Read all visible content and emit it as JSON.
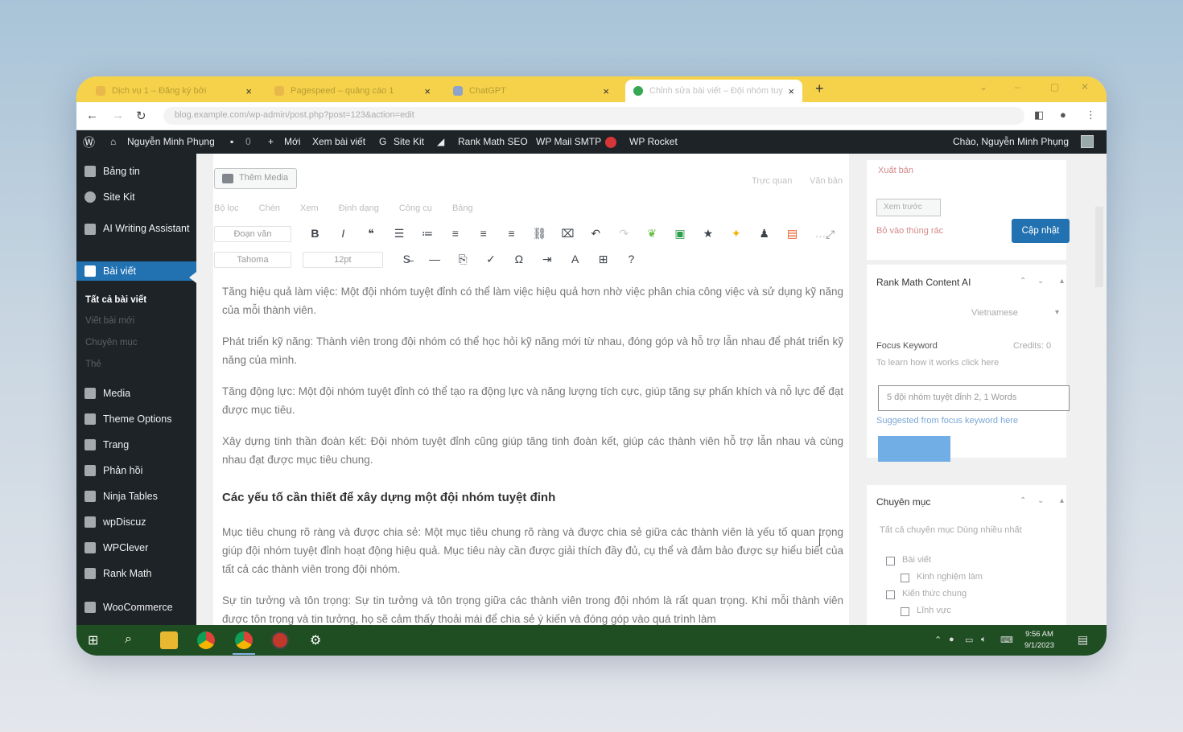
{
  "browser": {
    "tabs": [
      {
        "title": "Dịch vụ 1 – Đăng ký bởi",
        "active": false
      },
      {
        "title": "Pagespeed – quảng cáo 1",
        "active": false
      },
      {
        "title": "ChatGPT",
        "active": false
      },
      {
        "title": "Chỉnh sửa bài viết – Đội nhóm tuyệt",
        "active": true
      }
    ],
    "url": "blog.example.com/wp-admin/post.php?post=123&action=edit"
  },
  "admin_bar": {
    "site_name": "Nguyễn Minh Phụng",
    "comments": "0",
    "new": "Mới",
    "view_post": "Xem bài viết",
    "site_kit": "Site Kit",
    "rank_math": "Rank Math SEO",
    "wp_mail": "WP Mail SMTP",
    "wp_rocket": "WP Rocket",
    "greeting": "Chào, Nguyễn Minh Phụng"
  },
  "sidebar": {
    "items": {
      "dashboard": "Bảng tin",
      "site_kit": "Site Kit",
      "ai_writing": "AI Writing Assistant",
      "posts": "Bài viết",
      "media": "Media",
      "theme_options": "Theme Options",
      "pages": "Trang",
      "comments": "Phản hồi",
      "ninja_tables": "Ninja Tables",
      "wpdiscuz": "wpDiscuz",
      "wpclever": "WPClever",
      "rank_math": "Rank Math",
      "woocommerce": "WooCommerce"
    },
    "sub": {
      "all_posts": "Tất cả bài viết",
      "add_new": "Viết bài mới",
      "categories": "Chuyên mục",
      "tags": "Thẻ"
    }
  },
  "editor": {
    "add_media": "Thêm Media",
    "tab_visual": "Trực quan",
    "tab_text": "Văn bản",
    "toolbar_row1": [
      "Bộ lọc",
      "Chèn",
      "Xem",
      "Định dạng",
      "Công cụ",
      "Bảng"
    ],
    "format_select": "Đoạn văn",
    "font_select": "Tahoma",
    "size_select": "12pt",
    "paragraphs": [
      "Tăng hiệu quả làm việc: Một đội nhóm tuyệt đỉnh có thể làm việc hiệu quả hơn nhờ việc phân chia công việc và sử dụng kỹ năng của mỗi thành viên.",
      "Phát triển kỹ năng: Thành viên trong đội nhóm có thể học hỏi kỹ năng mới từ nhau, đóng góp và hỗ trợ lẫn nhau để phát triển kỹ năng của mình.",
      "Tăng động lực: Một đội nhóm tuyệt đỉnh có thể tạo ra động lực và năng lượng tích cực, giúp tăng sự phấn khích và nỗ lực để đạt được mục tiêu.",
      "Xây dựng tinh thần đoàn kết: Đội nhóm tuyệt đỉnh cũng giúp tăng tinh đoàn kết, giúp các thành viên hỗ trợ lẫn nhau và cùng nhau đạt được mục tiêu chung."
    ],
    "heading": "Các yếu tố cần thiết để xây dựng một đội nhóm tuyệt đỉnh",
    "paragraphs2": [
      "Mục tiêu chung rõ ràng và được chia sẻ: Một mục tiêu chung rõ ràng và được chia sẻ giữa các thành viên là yếu tố quan trọng giúp đội nhóm tuyệt đỉnh hoạt động hiệu quả. Mục tiêu này cần được giải thích đầy đủ, cụ thể và đảm bảo được sự hiểu biết của tất cả các thành viên trong đội nhóm.",
      "Sự tin tưởng và tôn trọng: Sự tin tưởng và tôn trọng giữa các thành viên trong đội nhóm là rất quan trọng. Khi mỗi thành viên được tôn trọng và tin tưởng, họ sẽ cảm thấy thoải mái để chia sẻ ý kiến và đóng góp vào quá trình làm"
    ]
  },
  "right_panel": {
    "publish_title": "Xuất bản",
    "preview": "Xem trước",
    "move_trash": "Bỏ vào thùng rác",
    "update": "Cập nhật",
    "rank_math_title": "Rank Math Content AI",
    "country": "Vietnamese",
    "focus_keyword": "Focus Keyword",
    "credits": "Credits: 0",
    "hint": "To learn how it works click here",
    "keyword_value": "5 đội nhóm tuyệt đỉnh 2, 1 Words",
    "keyword_note": "Suggested from focus keyword here",
    "categories_title": "Chuyên mục",
    "cat_tabs": "Tất cả chuyên mục   Dùng nhiều nhất",
    "cats": [
      "Bài viết",
      "Kinh nghiệm làm",
      "Kiến thức chung",
      "Lĩnh vực"
    ]
  },
  "taskbar": {
    "time": "9:56 AM",
    "date": "9/1/2023"
  }
}
